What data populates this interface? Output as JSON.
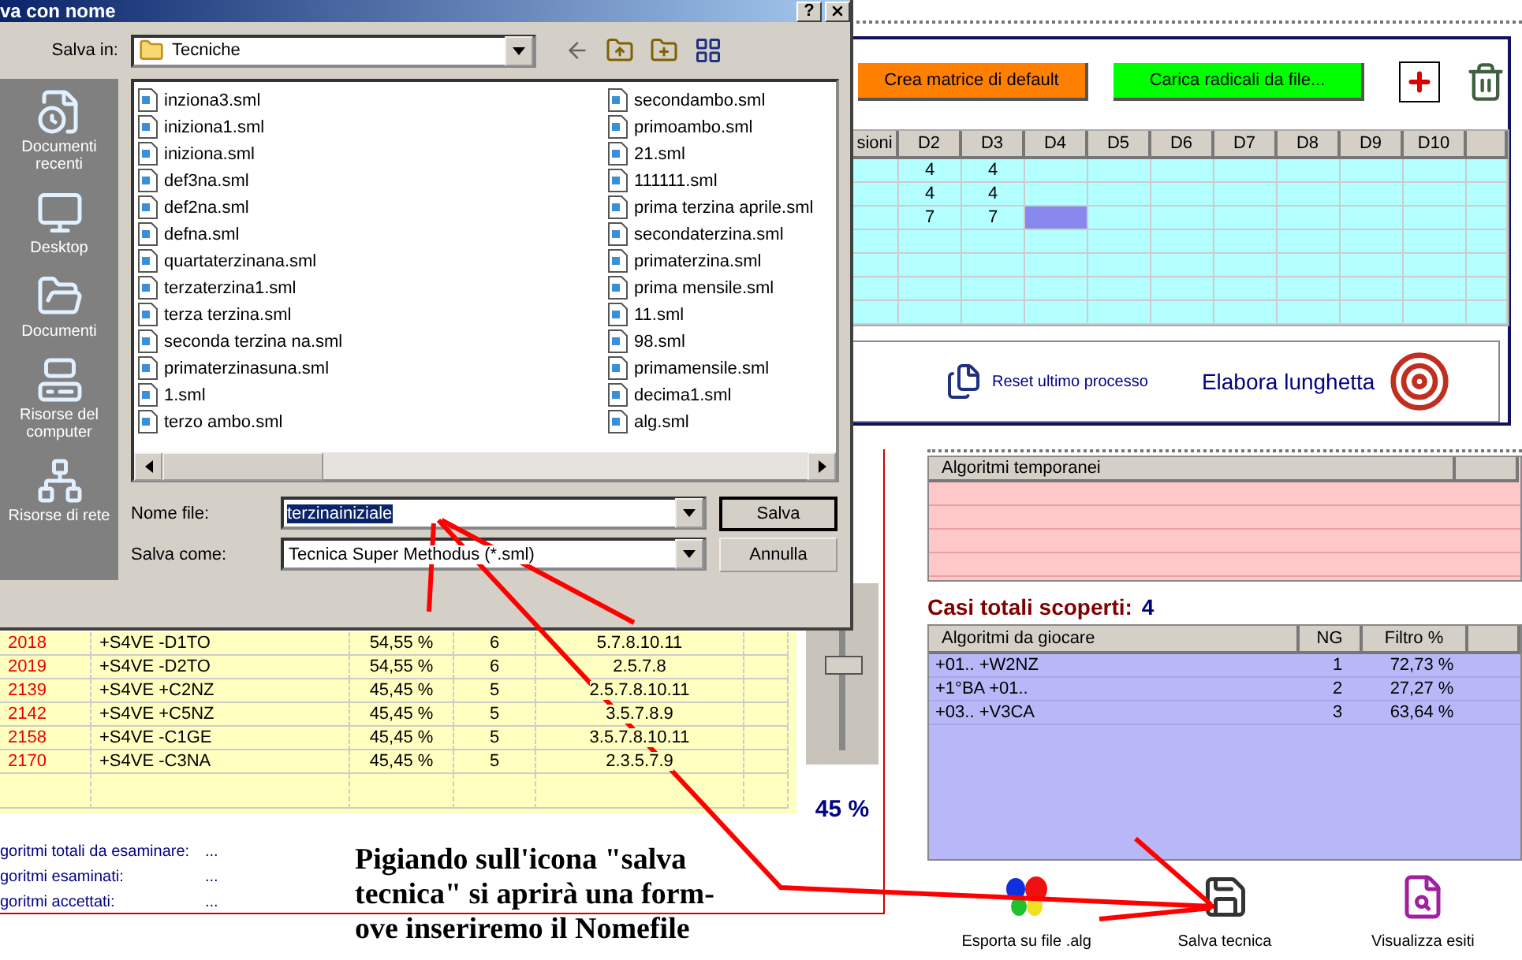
{
  "dialog": {
    "title": "va con nome",
    "help_button": "?",
    "save_in_label": "Salva in:",
    "folder": "Tecniche",
    "places": [
      {
        "label": "Documenti recenti",
        "kind": "recent"
      },
      {
        "label": "Desktop",
        "kind": "desktop"
      },
      {
        "label": "Documenti",
        "kind": "documents"
      },
      {
        "label": "Risorse del computer",
        "kind": "computer"
      },
      {
        "label": "Risorse di rete",
        "kind": "network"
      }
    ],
    "file_columns": [
      [
        "inziona3.sml",
        "iniziona1.sml",
        "iniziona.sml",
        "def3na.sml",
        "def2na.sml",
        "defna.sml",
        "quartaterzinana.sml",
        "terzaterzina1.sml",
        "terza terzina.sml",
        "seconda terzina na.sml",
        "primaterzinasuna.sml",
        "1.sml",
        "terzo ambo.sml"
      ],
      [
        "secondambo.sml",
        "primoambo.sml",
        "21.sml",
        "111111.sml",
        "prima terzina aprile.sml",
        "secondaterzina.sml",
        "primaterzina.sml",
        "prima mensile.sml",
        "11.sml",
        "98.sml",
        "primamensile.sml",
        "decima1.sml",
        "alg.sml"
      ]
    ],
    "filename_label": "Nome file:",
    "filename": "terzinainiziale",
    "filename_selected": true,
    "type_label": "Salva come:",
    "type_value": "Tecnica Super Methodus (*.sml)",
    "buttons": [
      {
        "label": "Salva",
        "default": true
      },
      {
        "label": "Annulla",
        "default": false
      }
    ]
  },
  "matrix_panel": {
    "buttons": [
      {
        "label": "Crea matrice di default",
        "color": "#ff8000"
      },
      {
        "label": "Carica radicali da file...",
        "color": "#00ff00"
      }
    ],
    "columns": [
      "sioni",
      "D2",
      "D3",
      "D4",
      "D5",
      "D6",
      "D7",
      "D8",
      "D9",
      "D10"
    ],
    "rows": [
      {
        "cells": [
          {
            "selected": false
          },
          {
            "text": "4",
            "selected": false
          },
          {
            "text": "4",
            "selected": false
          },
          {
            "selected": false
          },
          {
            "selected": false
          },
          {
            "selected": false
          },
          {
            "selected": false
          },
          {
            "selected": false
          },
          {
            "selected": false
          },
          {
            "selected": false
          }
        ]
      },
      {
        "cells": [
          {
            "selected": false
          },
          {
            "text": "4",
            "selected": false
          },
          {
            "text": "4",
            "selected": false
          },
          {
            "selected": false
          },
          {
            "selected": false
          },
          {
            "selected": false
          },
          {
            "selected": false
          },
          {
            "selected": false
          },
          {
            "selected": false
          },
          {
            "selected": false
          }
        ]
      },
      {
        "cells": [
          {
            "selected": false
          },
          {
            "text": "7",
            "selected": false
          },
          {
            "text": "7",
            "selected": false
          },
          {
            "selected": true
          },
          {
            "selected": false
          },
          {
            "selected": false
          },
          {
            "selected": false
          },
          {
            "selected": false
          },
          {
            "selected": false
          },
          {
            "selected": false
          }
        ]
      }
    ],
    "reset_label": "Reset ultimo processo",
    "process_label": "Elabora lunghetta"
  },
  "results": {
    "rows": [
      {
        "id": "2018",
        "algorithm": "+S4VE -D1TO",
        "percent": "54,55 %",
        "count": "6",
        "numbers": "5.7.8.10.11"
      },
      {
        "id": "2019",
        "algorithm": "+S4VE -D2TO",
        "percent": "54,55 %",
        "count": "6",
        "numbers": "2.5.7.8"
      },
      {
        "id": "2139",
        "algorithm": "+S4VE +C2NZ",
        "percent": "45,45 %",
        "count": "5",
        "numbers": "2.5.7.8.10.11"
      },
      {
        "id": "2142",
        "algorithm": "+S4VE +C5NZ",
        "percent": "45,45 %",
        "count": "5",
        "numbers": "3.5.7.8.9"
      },
      {
        "id": "2158",
        "algorithm": "+S4VE -C1GE",
        "percent": "45,45 %",
        "count": "5",
        "numbers": "3.5.7.8.10.11"
      },
      {
        "id": "2170",
        "algorithm": "+S4VE -C3NA",
        "percent": "45,45 %",
        "count": "5",
        "numbers": "2.3.5.7.9"
      }
    ],
    "slider": {
      "level": 0.55
    },
    "threshold": "45 %",
    "stats": [
      {
        "label": "goritmi totali da esaminare:",
        "value": "..."
      },
      {
        "label": "goritmi esaminati:",
        "value": "..."
      },
      {
        "label": "goritmi accettati:",
        "value": "..."
      }
    ]
  },
  "annotation_lines": [
    "Pigiando sull'icona \"salva",
    "tecnica\" si aprirà una form-",
    "ove inseriremo il Nomefile"
  ],
  "temporary": {
    "columns": [
      "Algoritmi temporanei"
    ]
  },
  "found": {
    "label": "Casi totali scoperti:",
    "value": "4"
  },
  "play_table": {
    "columns": [
      "Algoritmi da giocare",
      "NG",
      "Filtro %"
    ],
    "rows": [
      {
        "algorithm": "+01.. +W2NZ",
        "ng": "1",
        "filter": "72,73 %"
      },
      {
        "algorithm": "+1°BA +01..",
        "ng": "2",
        "filter": "27,27 %"
      },
      {
        "algorithm": "+03.. +V3CA",
        "ng": "3",
        "filter": "63,64 %"
      }
    ]
  },
  "actions": [
    {
      "label": "Esporta su file .alg",
      "kind": "export"
    },
    {
      "label": "Salva tecnica",
      "kind": "save"
    },
    {
      "label": "Visualizza esiti",
      "kind": "view"
    }
  ]
}
